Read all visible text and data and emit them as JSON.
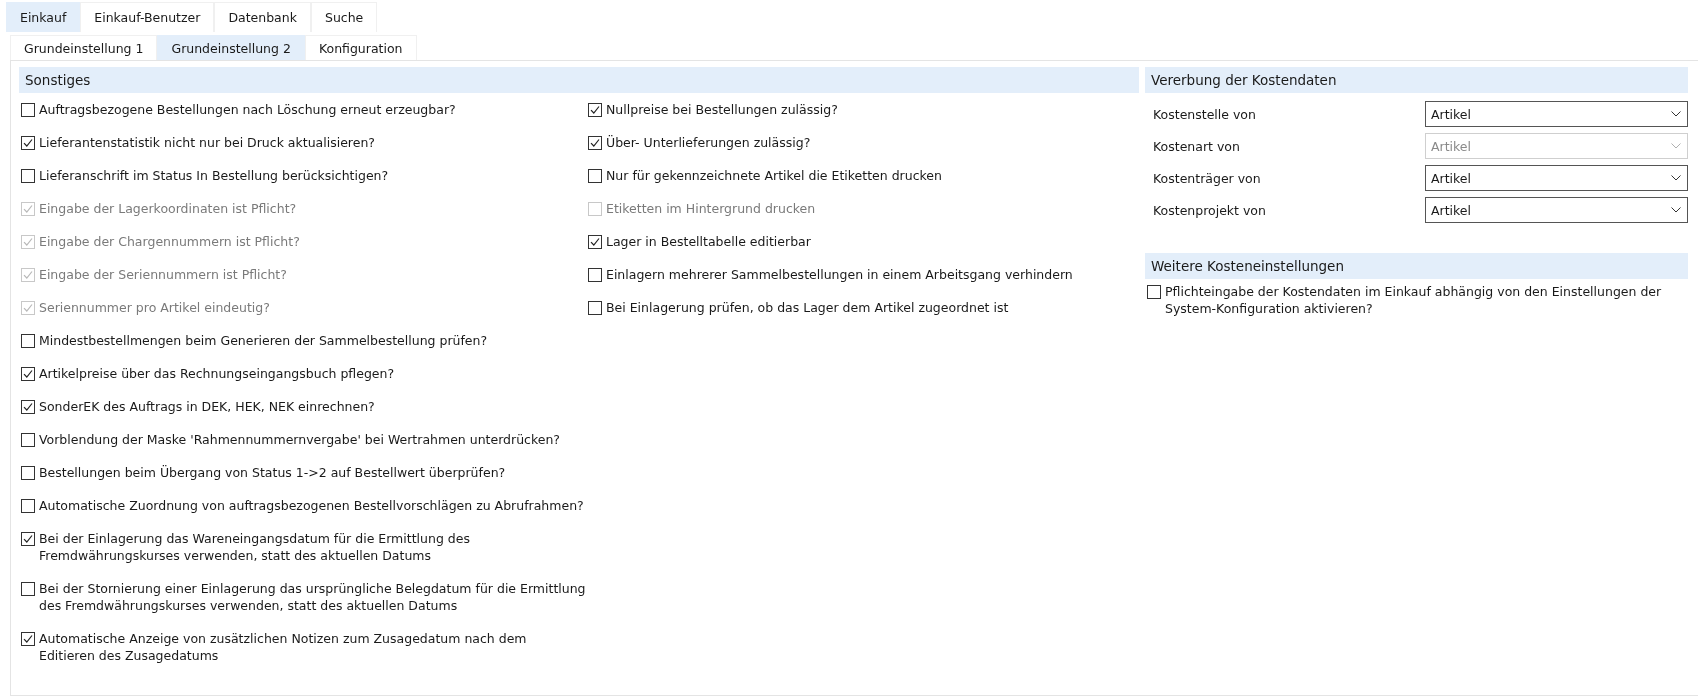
{
  "top_tabs": [
    {
      "label": "Einkauf",
      "selected": true
    },
    {
      "label": "Einkauf-Benutzer",
      "selected": false
    },
    {
      "label": "Datenbank",
      "selected": false
    },
    {
      "label": "Suche",
      "selected": false
    }
  ],
  "sub_tabs": [
    {
      "label": "Grundeinstellung 1",
      "selected": false
    },
    {
      "label": "Grundeinstellung 2",
      "selected": true
    },
    {
      "label": "Konfiguration",
      "selected": false
    }
  ],
  "sonstiges": {
    "title": "Sonstiges",
    "columns": [
      [
        {
          "label": "Auftragsbezogene Bestellungen nach Löschung erneut erzeugbar?",
          "checked": false,
          "disabled": false
        },
        {
          "label": "Lieferantenstatistik nicht nur bei Druck aktualisieren?",
          "checked": true,
          "disabled": false
        },
        {
          "label": "Lieferanschrift im Status In Bestellung berücksichtigen?",
          "checked": false,
          "disabled": false
        },
        {
          "label": "Eingabe der Lagerkoordinaten ist Pflicht?",
          "checked": true,
          "disabled": true
        },
        {
          "label": "Eingabe der Chargennummern ist Pflicht?",
          "checked": true,
          "disabled": true
        },
        {
          "label": "Eingabe der Seriennummern ist Pflicht?",
          "checked": true,
          "disabled": true
        },
        {
          "label": "Seriennummer pro Artikel eindeutig?",
          "checked": true,
          "disabled": true
        },
        {
          "label": "Mindestbestellmengen beim Generieren der Sammelbestellung prüfen?",
          "checked": false,
          "disabled": false
        },
        {
          "label": "Artikelpreise über das Rechnungseingangsbuch pflegen?",
          "checked": true,
          "disabled": false
        },
        {
          "label": "SonderEK des Auftrags in DEK, HEK, NEK einrechnen?",
          "checked": true,
          "disabled": false
        },
        {
          "label": "Vorblendung der Maske 'Rahmennummernvergabe' bei Wertrahmen unterdrücken?",
          "checked": false,
          "disabled": false
        },
        {
          "label": "Bestellungen beim Übergang von Status 1->2 auf Bestellwert überprüfen?",
          "checked": false,
          "disabled": false
        },
        {
          "label": "Automatische Zuordnung von auftragsbezogenen Bestellvorschlägen zu Abrufrahmen?",
          "checked": false,
          "disabled": false
        },
        {
          "label": "Bei der Einlagerung das Wareneingangsdatum für die Ermittlung des Fremdwährungskurses verwenden, statt des aktuellen Datums",
          "checked": true,
          "disabled": false
        },
        {
          "label": "Bei der Stornierung einer Einlagerung das ursprüngliche Belegdatum für die Ermittlung des Fremdwährungskurses verwenden, statt des aktuellen Datums",
          "checked": false,
          "disabled": false
        },
        {
          "label": "Automatische Anzeige von zusätzlichen Notizen zum Zusagedatum nach dem Editieren des Zusagedatums",
          "checked": true,
          "disabled": false
        }
      ],
      [
        {
          "label": "Nullpreise bei Bestellungen zulässig?",
          "checked": true,
          "disabled": false
        },
        {
          "label": "Über- Unterlieferungen zulässig?",
          "checked": true,
          "disabled": false
        },
        {
          "label": "Nur für gekennzeichnete Artikel die Etiketten drucken",
          "checked": false,
          "disabled": false
        },
        {
          "label": "Etiketten im Hintergrund drucken",
          "checked": false,
          "disabled": true
        },
        {
          "label": "Lager in Bestelltabelle editierbar",
          "checked": true,
          "disabled": false
        },
        {
          "label": "Einlagern mehrerer Sammelbestellungen in einem Arbeitsgang verhindern",
          "checked": false,
          "disabled": false
        },
        {
          "label": "Bei Einlagerung prüfen, ob das Lager dem Artikel zugeordnet ist",
          "checked": false,
          "disabled": false
        }
      ]
    ]
  },
  "kostendaten": {
    "title": "Vererbung der Kostendaten",
    "fields": [
      {
        "label": "Kostenstelle von",
        "value": "Artikel",
        "disabled": false
      },
      {
        "label": "Kostenart von",
        "value": "Artikel",
        "disabled": true
      },
      {
        "label": "Kostenträger von",
        "value": "Artikel",
        "disabled": false
      },
      {
        "label": "Kostenprojekt von",
        "value": "Artikel",
        "disabled": false
      }
    ]
  },
  "weitere": {
    "title": "Weitere Kosteneinstellungen",
    "options": [
      {
        "label": "Pflichteingabe der Kostendaten im Einkauf abhängig von den Einstellungen der System-Konfiguration aktivieren?",
        "checked": false,
        "disabled": false
      }
    ]
  }
}
